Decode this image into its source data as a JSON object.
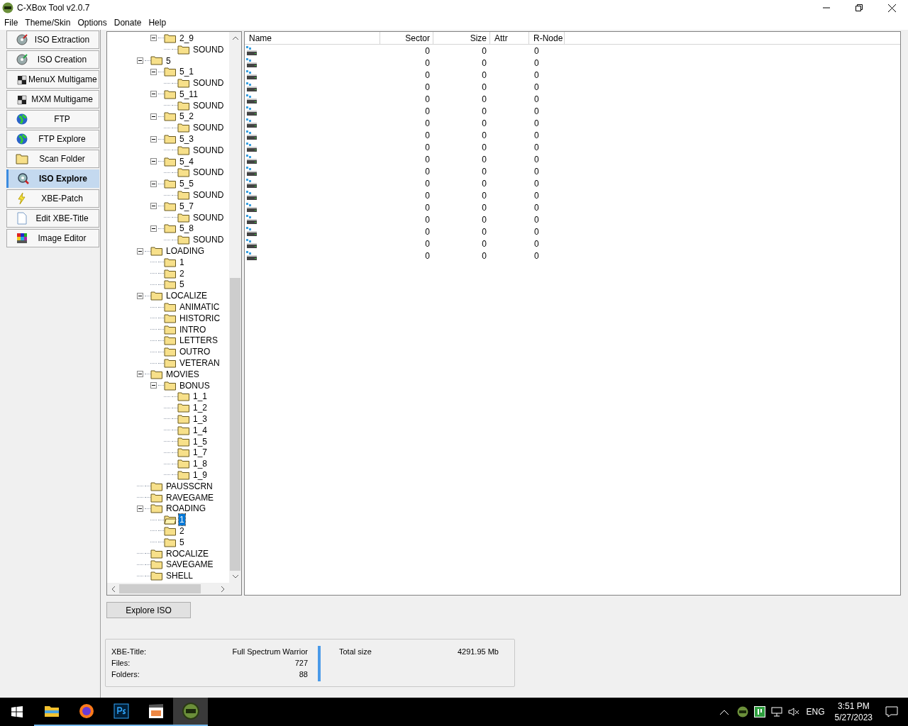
{
  "window": {
    "title": "C-XBox Tool v2.0.7"
  },
  "menu": [
    "File",
    "Theme/Skin",
    "Options",
    "Donate",
    "Help"
  ],
  "sidebar": {
    "items": [
      {
        "label": "ISO Extraction",
        "selected": false
      },
      {
        "label": "ISO Creation",
        "selected": false
      },
      {
        "label": "MenuX Multigame",
        "selected": false
      },
      {
        "label": "MXM Multigame",
        "selected": false
      },
      {
        "label": "FTP",
        "selected": false
      },
      {
        "label": "FTP Explore",
        "selected": false
      },
      {
        "label": "Scan Folder",
        "selected": false
      },
      {
        "label": "ISO Explore",
        "selected": true
      },
      {
        "label": "XBE-Patch",
        "selected": false
      },
      {
        "label": "Edit XBE-Title",
        "selected": false
      },
      {
        "label": "Image Editor",
        "selected": false
      }
    ]
  },
  "tree": {
    "cut_off_branch": [
      {
        "label": "2_9",
        "selected": false,
        "expanded": true,
        "children": [
          {
            "label": "SOUND",
            "selected": false
          }
        ]
      }
    ],
    "items": [
      {
        "label": "5",
        "selected": false,
        "expanded": true,
        "children": [
          {
            "label": "5_1",
            "selected": false,
            "expanded": true,
            "children": [
              {
                "label": "SOUND",
                "selected": false
              }
            ]
          },
          {
            "label": "5_11",
            "selected": false,
            "expanded": true,
            "children": [
              {
                "label": "SOUND",
                "selected": false
              }
            ]
          },
          {
            "label": "5_2",
            "selected": false,
            "expanded": true,
            "children": [
              {
                "label": "SOUND",
                "selected": false
              }
            ]
          },
          {
            "label": "5_3",
            "selected": false,
            "expanded": true,
            "children": [
              {
                "label": "SOUND",
                "selected": false
              }
            ]
          },
          {
            "label": "5_4",
            "selected": false,
            "expanded": true,
            "children": [
              {
                "label": "SOUND",
                "selected": false
              }
            ]
          },
          {
            "label": "5_5",
            "selected": false,
            "expanded": true,
            "children": [
              {
                "label": "SOUND",
                "selected": false
              }
            ]
          },
          {
            "label": "5_7",
            "selected": false,
            "expanded": true,
            "children": [
              {
                "label": "SOUND",
                "selected": false
              }
            ]
          },
          {
            "label": "5_8",
            "selected": false,
            "expanded": true,
            "children": [
              {
                "label": "SOUND",
                "selected": false
              }
            ]
          }
        ]
      },
      {
        "label": "LOADING",
        "selected": false,
        "expanded": true,
        "children": [
          {
            "label": "1",
            "selected": false
          },
          {
            "label": "2",
            "selected": false
          },
          {
            "label": "5",
            "selected": false
          }
        ]
      },
      {
        "label": "LOCALIZE",
        "selected": false,
        "expanded": true,
        "children": [
          {
            "label": "ANIMATIC",
            "selected": false
          },
          {
            "label": "HISTORIC",
            "selected": false
          },
          {
            "label": "INTRO",
            "selected": false
          },
          {
            "label": "LETTERS",
            "selected": false
          },
          {
            "label": "OUTRO",
            "selected": false
          },
          {
            "label": "VETERAN",
            "selected": false
          }
        ]
      },
      {
        "label": "MOVIES",
        "selected": false,
        "expanded": true,
        "children": [
          {
            "label": "BONUS",
            "selected": false,
            "expanded": true,
            "children": [
              {
                "label": "1_1",
                "selected": false
              },
              {
                "label": "1_2",
                "selected": false
              },
              {
                "label": "1_3",
                "selected": false
              },
              {
                "label": "1_4",
                "selected": false
              },
              {
                "label": "1_5",
                "selected": false
              },
              {
                "label": "1_7",
                "selected": false
              },
              {
                "label": "1_8",
                "selected": false
              },
              {
                "label": "1_9",
                "selected": false
              }
            ]
          }
        ]
      },
      {
        "label": "PAUSSCRN",
        "selected": false
      },
      {
        "label": "RAVEGAME",
        "selected": false
      },
      {
        "label": "ROADING",
        "selected": false,
        "expanded": true,
        "children": [
          {
            "label": "1",
            "selected": true
          },
          {
            "label": "2",
            "selected": false
          },
          {
            "label": "5",
            "selected": false
          }
        ]
      },
      {
        "label": "ROCALIZE",
        "selected": false
      },
      {
        "label": "SAVEGAME",
        "selected": false
      },
      {
        "label": "SHELL",
        "selected": false
      }
    ]
  },
  "table": {
    "columns": [
      "Name",
      "Sector",
      "Size",
      "Attr",
      "R-Node"
    ],
    "rows": [
      {
        "sector": "0",
        "size": "0",
        "r_node": "0"
      },
      {
        "sector": "0",
        "size": "0",
        "r_node": "0"
      },
      {
        "sector": "0",
        "size": "0",
        "r_node": "0"
      },
      {
        "sector": "0",
        "size": "0",
        "r_node": "0"
      },
      {
        "sector": "0",
        "size": "0",
        "r_node": "0"
      },
      {
        "sector": "0",
        "size": "0",
        "r_node": "0"
      },
      {
        "sector": "0",
        "size": "0",
        "r_node": "0"
      },
      {
        "sector": "0",
        "size": "0",
        "r_node": "0"
      },
      {
        "sector": "0",
        "size": "0",
        "r_node": "0"
      },
      {
        "sector": "0",
        "size": "0",
        "r_node": "0"
      },
      {
        "sector": "0",
        "size": "0",
        "r_node": "0"
      },
      {
        "sector": "0",
        "size": "0",
        "r_node": "0"
      },
      {
        "sector": "0",
        "size": "0",
        "r_node": "0"
      },
      {
        "sector": "0",
        "size": "0",
        "r_node": "0"
      },
      {
        "sector": "0",
        "size": "0",
        "r_node": "0"
      },
      {
        "sector": "0",
        "size": "0",
        "r_node": "0"
      },
      {
        "sector": "0",
        "size": "0",
        "r_node": "0"
      },
      {
        "sector": "0",
        "size": "0",
        "r_node": "0"
      }
    ]
  },
  "explore_button": "Explore ISO",
  "info": {
    "left": [
      {
        "label": "XBE-Title:",
        "value": "Full Spectrum Warrior"
      },
      {
        "label": "Files:",
        "value": "727"
      },
      {
        "label": "Folders:",
        "value": "88"
      }
    ],
    "right": [
      {
        "label": "Total size",
        "value": "4291.95 Mb"
      }
    ]
  },
  "taskbar": {
    "apps": [
      {
        "selected": false
      },
      {
        "selected": false
      },
      {
        "selected": false
      },
      {
        "selected": false
      },
      {
        "selected": true
      }
    ],
    "language": "ENG",
    "time": "3:51 PM",
    "date": "5/27/2023"
  }
}
